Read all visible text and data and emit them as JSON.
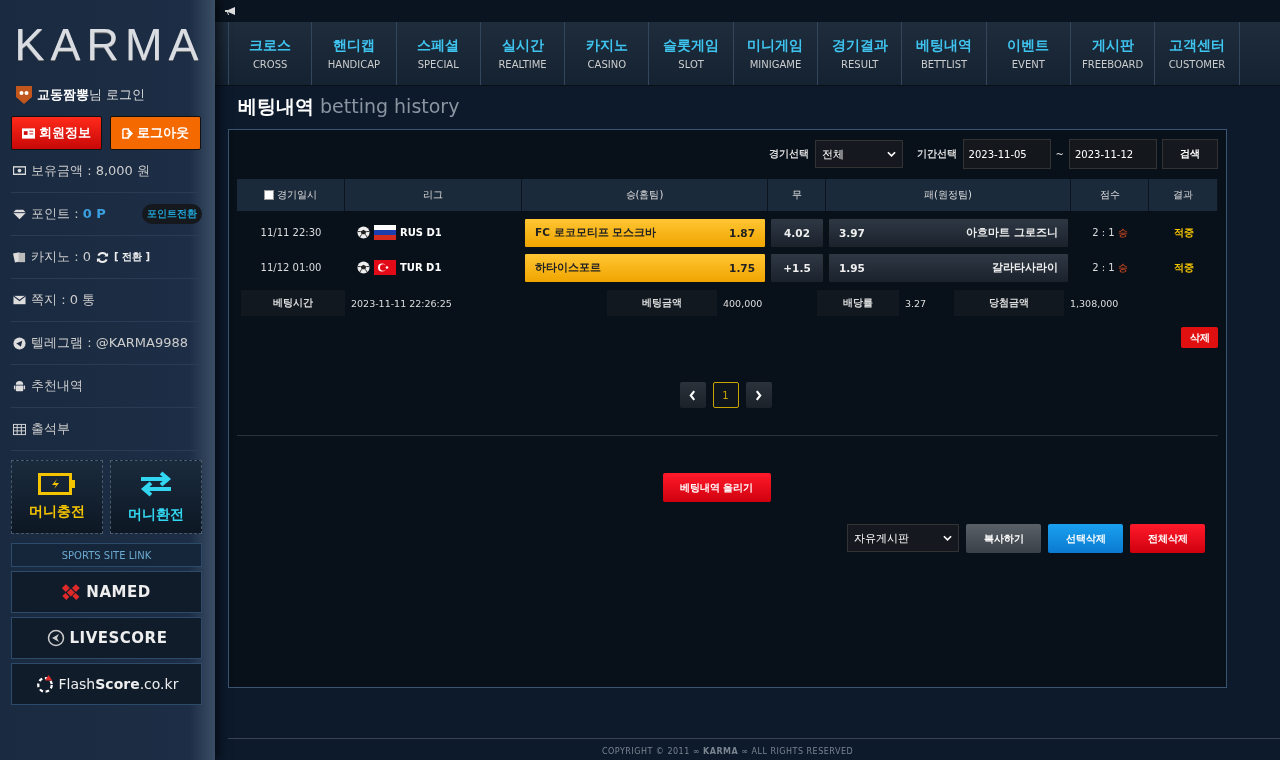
{
  "sidebar": {
    "logo": "KARMA",
    "user": {
      "name": "교동짬뽕",
      "suffix": "님 로그인"
    },
    "buttons": [
      {
        "kind": "info",
        "label": "회원정보"
      },
      {
        "kind": "logout",
        "label": "로그아웃"
      }
    ],
    "items": [
      {
        "kind": "money",
        "label": "보유금액 : 8,000 원"
      },
      {
        "kind": "point",
        "label": "포인트 : ",
        "value": "0 P",
        "action": "포인트전환"
      },
      {
        "kind": "casino",
        "label": "카지노 : 0",
        "action": "[ 전환 ]"
      },
      {
        "kind": "message",
        "label": "쪽지 : 0 통"
      },
      {
        "kind": "telegram",
        "label": "텔레그램 : @KARMA9988"
      },
      {
        "kind": "recommend",
        "label": "추천내역"
      },
      {
        "kind": "attendance",
        "label": "출석부"
      }
    ],
    "money_buttons": [
      {
        "kind": "charge",
        "label": "머니충전"
      },
      {
        "kind": "exchange",
        "label": "머니환전"
      }
    ],
    "link_header": "SPORTS SITE LINK",
    "links": [
      {
        "kind": "named",
        "label": "NAMED"
      },
      {
        "kind": "livescore",
        "label": "LIVESCORE"
      },
      {
        "kind": "flashscore",
        "label": "Flash**Score**.co.kr"
      }
    ]
  },
  "nav": [
    {
      "label": "크로스",
      "sub": "CROSS",
      "selected": false
    },
    {
      "label": "핸디캡",
      "sub": "HANDICAP",
      "selected": false
    },
    {
      "label": "스페셜",
      "sub": "SPECIAL",
      "selected": false
    },
    {
      "label": "실시간",
      "sub": "REALTIME",
      "selected": false
    },
    {
      "label": "카지노",
      "sub": "CASINO",
      "selected": false
    },
    {
      "label": "슬롯게임",
      "sub": "SLOT",
      "selected": false
    },
    {
      "label": "미니게임",
      "sub": "MINIGAME",
      "selected": false
    },
    {
      "label": "경기결과",
      "sub": "RESULT",
      "selected": false
    },
    {
      "label": "베팅내역",
      "sub": "BETTLIST",
      "selected": false
    },
    {
      "label": "이벤트",
      "sub": "EVENT",
      "selected": false
    },
    {
      "label": "게시판",
      "sub": "FREEBOARD",
      "selected": false
    },
    {
      "label": "고객센터",
      "sub": "CUSTOMER",
      "selected": false
    }
  ],
  "page_title": {
    "title": "베팅내역",
    "subtitle": "betting history"
  },
  "filters": {
    "game_label": "경기선택",
    "game_value": "전체",
    "period_label": "기간선택",
    "from": "2023-11-05",
    "separator": "~",
    "to": "2023-11-12",
    "search": "검색"
  },
  "table": {
    "select_all": {
      "checked": false
    },
    "columns": [
      "경기일시",
      "리그",
      "승(홈팀)",
      "무",
      "패(원정팀)",
      "점수",
      "결과"
    ],
    "rows": [
      {
        "time": "11/11 22:30",
        "kind": "russia",
        "league": "RUS D1",
        "home": {
          "name": "FC 로코모티프 모스크바",
          "odds": "1.87",
          "selected": true
        },
        "draw": {
          "value": "4.02",
          "selected": false
        },
        "away": {
          "odds": "3.97",
          "name": "아흐마트 그로즈니",
          "selected": false
        },
        "score": "2 : 1",
        "outcome": "승",
        "result": "적중"
      },
      {
        "time": "11/12 01:00",
        "kind": "turkey",
        "league": "TUR D1",
        "home": {
          "name": "하타이스포르",
          "odds": "1.75",
          "selected": true
        },
        "draw": {
          "value": "+1.5",
          "selected": false
        },
        "away": {
          "odds": "1.95",
          "name": "갈라타사라이",
          "selected": false
        },
        "score": "2 : 1",
        "outcome": "승",
        "result": "적중"
      }
    ],
    "summary": [
      {
        "label": "베팅시간",
        "value": "2023-11-11 22:26:25"
      },
      {
        "label": "베팅금액",
        "value": "400,000"
      },
      {
        "label": "배당률",
        "value": "3.27"
      },
      {
        "label": "당첨금액",
        "value": "1,308,000"
      }
    ],
    "delete": "삭제"
  },
  "pagination": {
    "pages": [
      {
        "label": "1",
        "selected": true
      }
    ]
  },
  "upload_button": "베팅내역 올리기",
  "board_select": "자유게시판",
  "actions": [
    {
      "kind": "copy",
      "label": "복사하기"
    },
    {
      "kind": "select",
      "label": "선택삭제"
    },
    {
      "kind": "all",
      "label": "전체삭제"
    }
  ],
  "footer": "COPYRIGHT © 2011 ∞ **KARMA** ∞ ALL RIGHTS RESERVED"
}
